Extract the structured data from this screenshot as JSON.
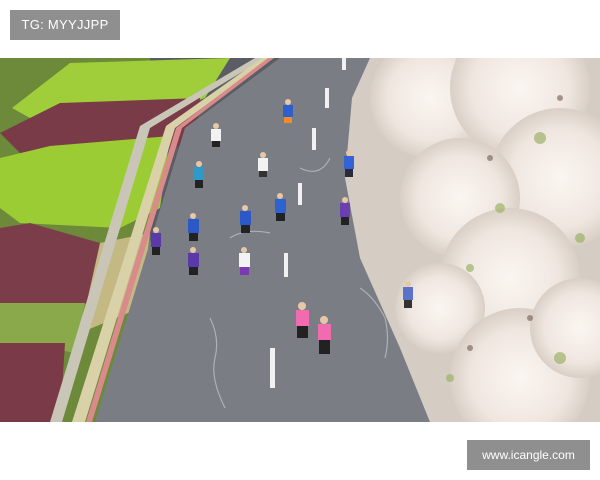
{
  "watermark_top": "TG: MYYJJPP",
  "watermark_bottom": "www.icangle.com"
}
